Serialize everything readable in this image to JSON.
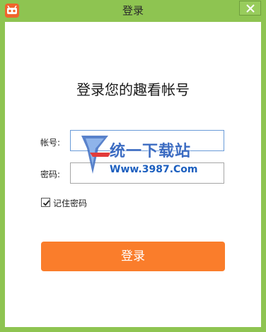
{
  "window": {
    "title": "登录",
    "icon": "app-logo-icon",
    "close_icon": "close-icon",
    "colors": {
      "frame": "#8ec451",
      "accent": "#fa7d2b"
    }
  },
  "form": {
    "heading": "登录您的趣看帐号",
    "account_label": "帐号:",
    "account_value": "",
    "password_label": "密码:",
    "password_value": "",
    "remember_label": "记住密码",
    "remember_checked": true,
    "login_button": "登录"
  },
  "watermark": {
    "name": "统一下载站",
    "url": "Www.3987.Com"
  }
}
